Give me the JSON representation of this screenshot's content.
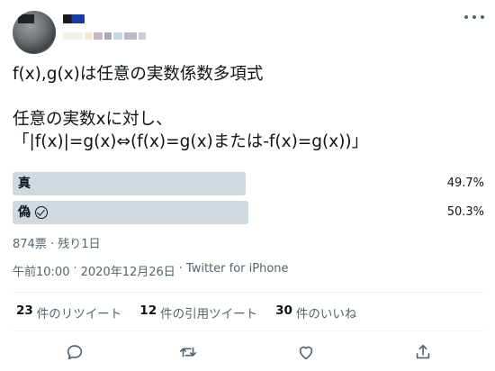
{
  "tweet": {
    "text": "f(x),g(x)は任意の実数係数多項式\n\n任意の実数xに対し、\n「|f(x)|=g(x)⇔(f(x)=g(x)または-f(x)=g(x))」"
  },
  "poll": {
    "options": [
      {
        "label": "真",
        "percent_text": "49.7%",
        "percent": 49.7
      },
      {
        "label": "偽",
        "percent_text": "50.3%",
        "percent": 50.3
      }
    ],
    "meta": "874票 · 残り1日"
  },
  "timestamp": {
    "time": "午前10:00",
    "sep1": "·",
    "date": "2020年12月26日",
    "sep2": "·",
    "source": "Twitter for iPhone"
  },
  "stats": {
    "retweets": {
      "count": "23",
      "label": "件のリツイート"
    },
    "quotes": {
      "count": "12",
      "label": "件の引用ツイート"
    },
    "likes": {
      "count": "30",
      "label": "件のいいね"
    }
  },
  "icons": {
    "more": "more-icon",
    "reply": "reply-icon",
    "retweet": "retweet-icon",
    "like": "like-icon",
    "share": "share-icon",
    "selected": "check-circle-icon"
  },
  "colors": {
    "bar": "#cfd9de",
    "secondary_text": "#536471",
    "primary_text": "#0f1419"
  }
}
